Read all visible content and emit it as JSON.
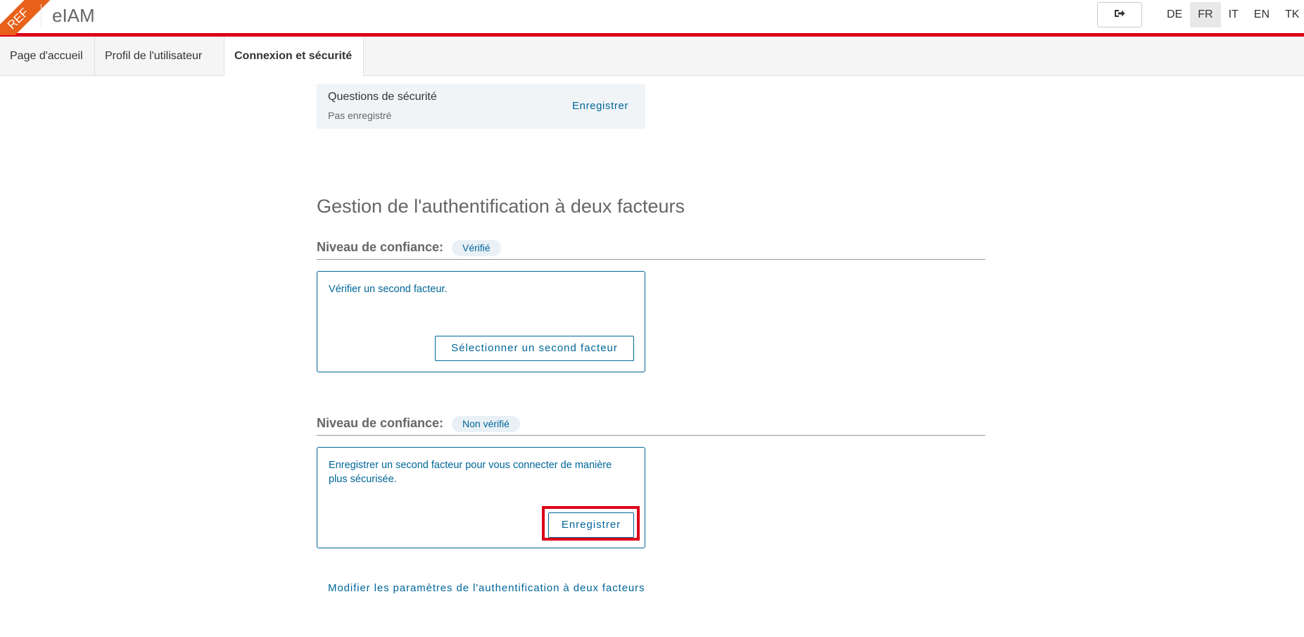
{
  "header": {
    "env_badge": "REF",
    "app_title": "eIAM",
    "logout_icon": "logout-icon",
    "languages": [
      {
        "code": "DE",
        "active": false
      },
      {
        "code": "FR",
        "active": true
      },
      {
        "code": "IT",
        "active": false
      },
      {
        "code": "EN",
        "active": false
      },
      {
        "code": "TK",
        "active": false
      }
    ]
  },
  "tabs": [
    {
      "label": "Page d'accueil",
      "active": false
    },
    {
      "label": "Profil de l'utilisateur",
      "active": false
    },
    {
      "label": "Connexion et sécurité",
      "active": true
    }
  ],
  "security_questions": {
    "title": "Questions de sécurité",
    "status": "Pas enregistré",
    "action": "Enregistrer"
  },
  "two_factor": {
    "title": "Gestion de l'authentification à deux facteurs",
    "verified": {
      "label": "Niveau de confiance:",
      "badge": "Vérifié",
      "text": "Vérifier un second facteur.",
      "button": "Sélectionner un second facteur"
    },
    "unverified": {
      "label": "Niveau de confiance:",
      "badge": "Non vérifié",
      "text": "Enregistrer un second facteur pour vous connecter de manière plus sécurisée.",
      "button": "Enregistrer"
    },
    "settings_link": "Modifier les paramètres de l'authentification à deux facteurs"
  },
  "colors": {
    "brand_red": "#dc0018",
    "ref_orange": "#e8611a",
    "link_blue": "#006699"
  }
}
